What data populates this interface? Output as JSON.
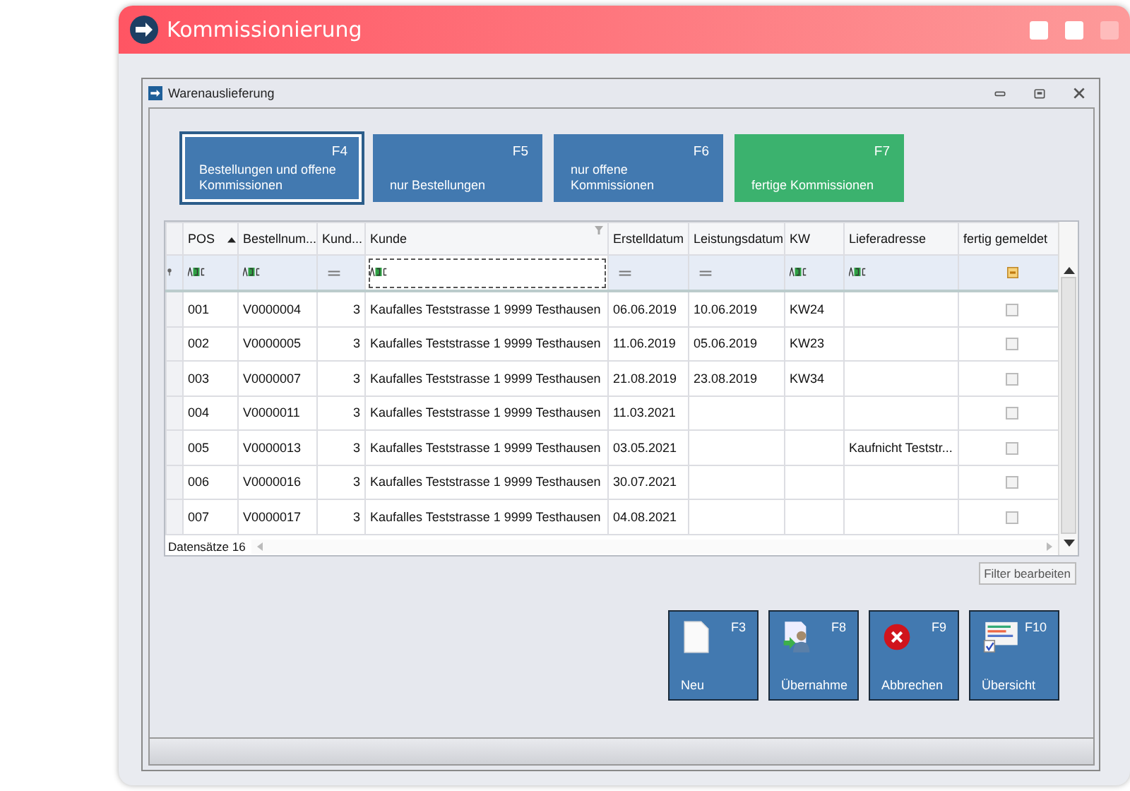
{
  "window": {
    "title": "Kommissionierung"
  },
  "child_window": {
    "title": "Warenauslieferung"
  },
  "filter_tiles": [
    {
      "key": "F4",
      "label": "Bestellungen und offene Kommissionen",
      "selected": true,
      "color": "#4279b0"
    },
    {
      "key": "F5",
      "label": "nur Bestellungen",
      "selected": false,
      "color": "#4279b0"
    },
    {
      "key": "F6",
      "label": "nur offene Kommissionen",
      "selected": false,
      "color": "#4279b0"
    },
    {
      "key": "F7",
      "label": "fertige Kommissionen",
      "selected": false,
      "color": "#3bb26e"
    }
  ],
  "table": {
    "columns": [
      {
        "label": "POS",
        "sorted_ascending": true,
        "kind": "text"
      },
      {
        "label": "Bestellnum...",
        "kind": "text"
      },
      {
        "label": "Kund...",
        "kind": "number"
      },
      {
        "label": "Kunde",
        "filtered": true,
        "kind": "text"
      },
      {
        "label": "Erstelldatum",
        "kind": "date"
      },
      {
        "label": "Leistungsdatum",
        "kind": "date"
      },
      {
        "label": "KW",
        "kind": "text"
      },
      {
        "label": "Lieferadresse",
        "kind": "text"
      },
      {
        "label": "fertig gemeldet",
        "kind": "check"
      }
    ],
    "rows": [
      {
        "cells": [
          "001",
          "V0000004",
          "3",
          "Kaufalles Teststrasse 1 9999 Testhausen",
          "06.06.2019",
          "10.06.2019",
          "KW24",
          ""
        ],
        "done": false
      },
      {
        "cells": [
          "002",
          "V0000005",
          "3",
          "Kaufalles Teststrasse 1 9999 Testhausen",
          "11.06.2019",
          "05.06.2019",
          "KW23",
          ""
        ],
        "done": false
      },
      {
        "cells": [
          "003",
          "V0000007",
          "3",
          "Kaufalles Teststrasse 1 9999 Testhausen",
          "21.08.2019",
          "23.08.2019",
          "KW34",
          ""
        ],
        "done": false
      },
      {
        "cells": [
          "004",
          "V0000011",
          "3",
          "Kaufalles Teststrasse 1 9999 Testhausen",
          "11.03.2021",
          "",
          "",
          ""
        ],
        "done": false
      },
      {
        "cells": [
          "005",
          "V0000013",
          "3",
          "Kaufalles Teststrasse 1 9999 Testhausen",
          "03.05.2021",
          "",
          "",
          "Kaufnicht Teststr..."
        ],
        "done": false
      },
      {
        "cells": [
          "006",
          "V0000016",
          "3",
          "Kaufalles Teststrasse 1 9999 Testhausen",
          "30.07.2021",
          "",
          "",
          ""
        ],
        "done": false
      },
      {
        "cells": [
          "007",
          "V0000017",
          "3",
          "Kaufalles Teststrasse 1 9999 Testhausen",
          "04.08.2021",
          "",
          "",
          ""
        ],
        "done": false
      }
    ],
    "record_count": "Datensätze 16"
  },
  "filter_button": "Filter bearbeiten",
  "actions": [
    {
      "key": "F3",
      "label": "Neu",
      "kind": "new"
    },
    {
      "key": "F8",
      "label": "Übernahme",
      "kind": "transfer"
    },
    {
      "key": "F9",
      "label": "Abbrechen",
      "kind": "cancel"
    },
    {
      "key": "F10",
      "label": "Übersicht",
      "kind": "overview"
    }
  ]
}
